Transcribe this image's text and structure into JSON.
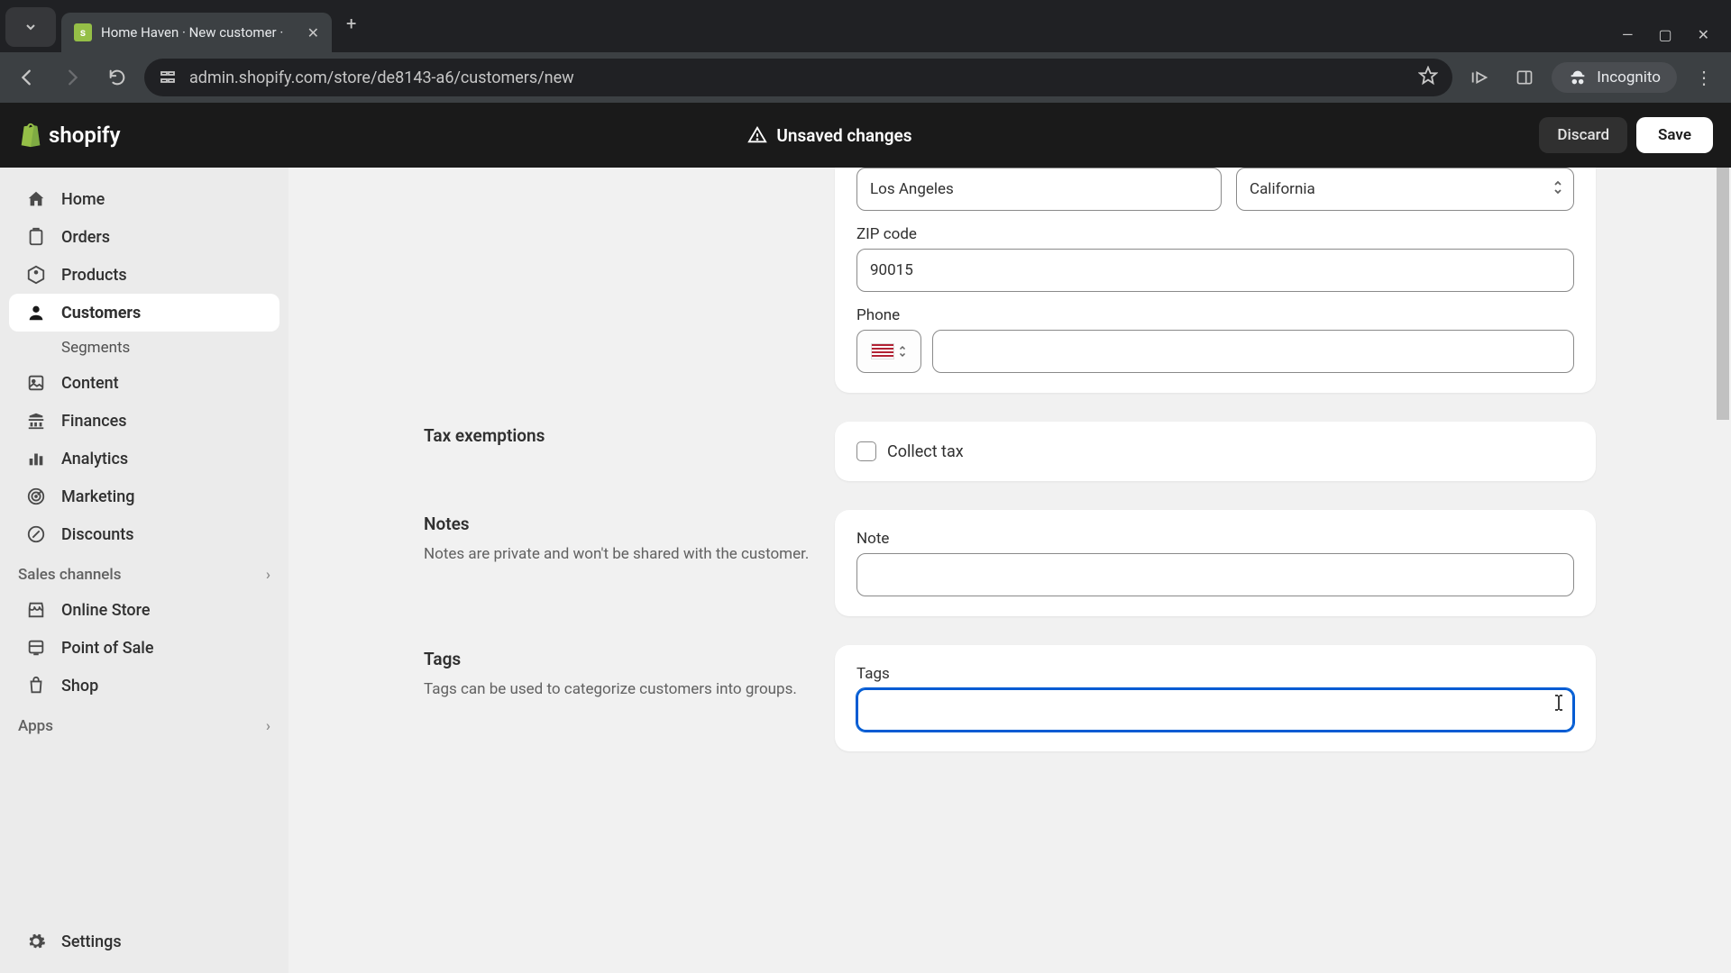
{
  "browser": {
    "tab_title": "Home Haven · New customer ·",
    "url": "admin.shopify.com/store/de8143-a6/customers/new",
    "incognito_label": "Incognito"
  },
  "topbar": {
    "unsaved_label": "Unsaved changes",
    "discard_label": "Discard",
    "save_label": "Save",
    "logo_text": "shopify"
  },
  "sidebar": {
    "items": [
      {
        "label": "Home"
      },
      {
        "label": "Orders"
      },
      {
        "label": "Products"
      },
      {
        "label": "Customers"
      },
      {
        "label": "Content"
      },
      {
        "label": "Finances"
      },
      {
        "label": "Analytics"
      },
      {
        "label": "Marketing"
      },
      {
        "label": "Discounts"
      }
    ],
    "customers_sub": "Segments",
    "sales_channels_label": "Sales channels",
    "channels": [
      {
        "label": "Online Store"
      },
      {
        "label": "Point of Sale"
      },
      {
        "label": "Shop"
      }
    ],
    "apps_label": "Apps",
    "settings_label": "Settings"
  },
  "form": {
    "city_value": "Los Angeles",
    "state_value": "California",
    "zip_label": "ZIP code",
    "zip_value": "90015",
    "phone_label": "Phone",
    "phone_value": "",
    "tax": {
      "section_title": "Tax exemptions",
      "checkbox_label": "Collect tax"
    },
    "notes": {
      "section_title": "Notes",
      "section_desc": "Notes are private and won't be shared with the customer.",
      "field_label": "Note",
      "value": ""
    },
    "tags": {
      "section_title": "Tags",
      "section_desc": "Tags can be used to categorize customers into groups.",
      "field_label": "Tags",
      "value": ""
    }
  }
}
